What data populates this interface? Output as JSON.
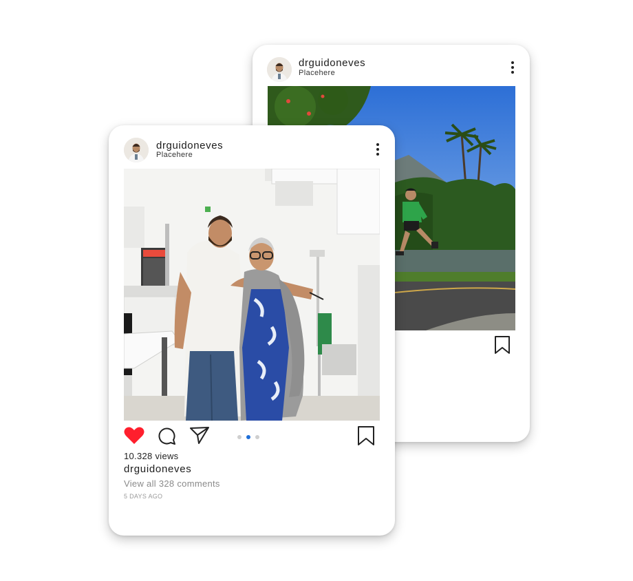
{
  "back_post": {
    "username": "drguidoneves",
    "location": "Placehere",
    "avatar_icon": "profile-photo",
    "more_icon": "more-vertical-icon",
    "bookmark_icon": "bookmark-icon"
  },
  "front_post": {
    "username": "drguidoneves",
    "location": "Placehere",
    "avatar_icon": "profile-photo",
    "more_icon": "more-vertical-icon",
    "like_icon": "heart-filled-icon",
    "comment_icon": "comment-icon",
    "share_icon": "send-icon",
    "bookmark_icon": "bookmark-icon",
    "carousel": {
      "count": 3,
      "active": 2
    },
    "views": "10.328 views",
    "caption_username": "drguidoneves",
    "comments_link": "View all 328 comments",
    "timestamp": "5 DAYS AGO"
  },
  "colors": {
    "like_red": "#ff1f2d",
    "carousel_active": "#1f6fd8",
    "carousel_inactive": "#cfcfcf",
    "text": "#1c1c1c",
    "muted": "#8a8a8a"
  }
}
